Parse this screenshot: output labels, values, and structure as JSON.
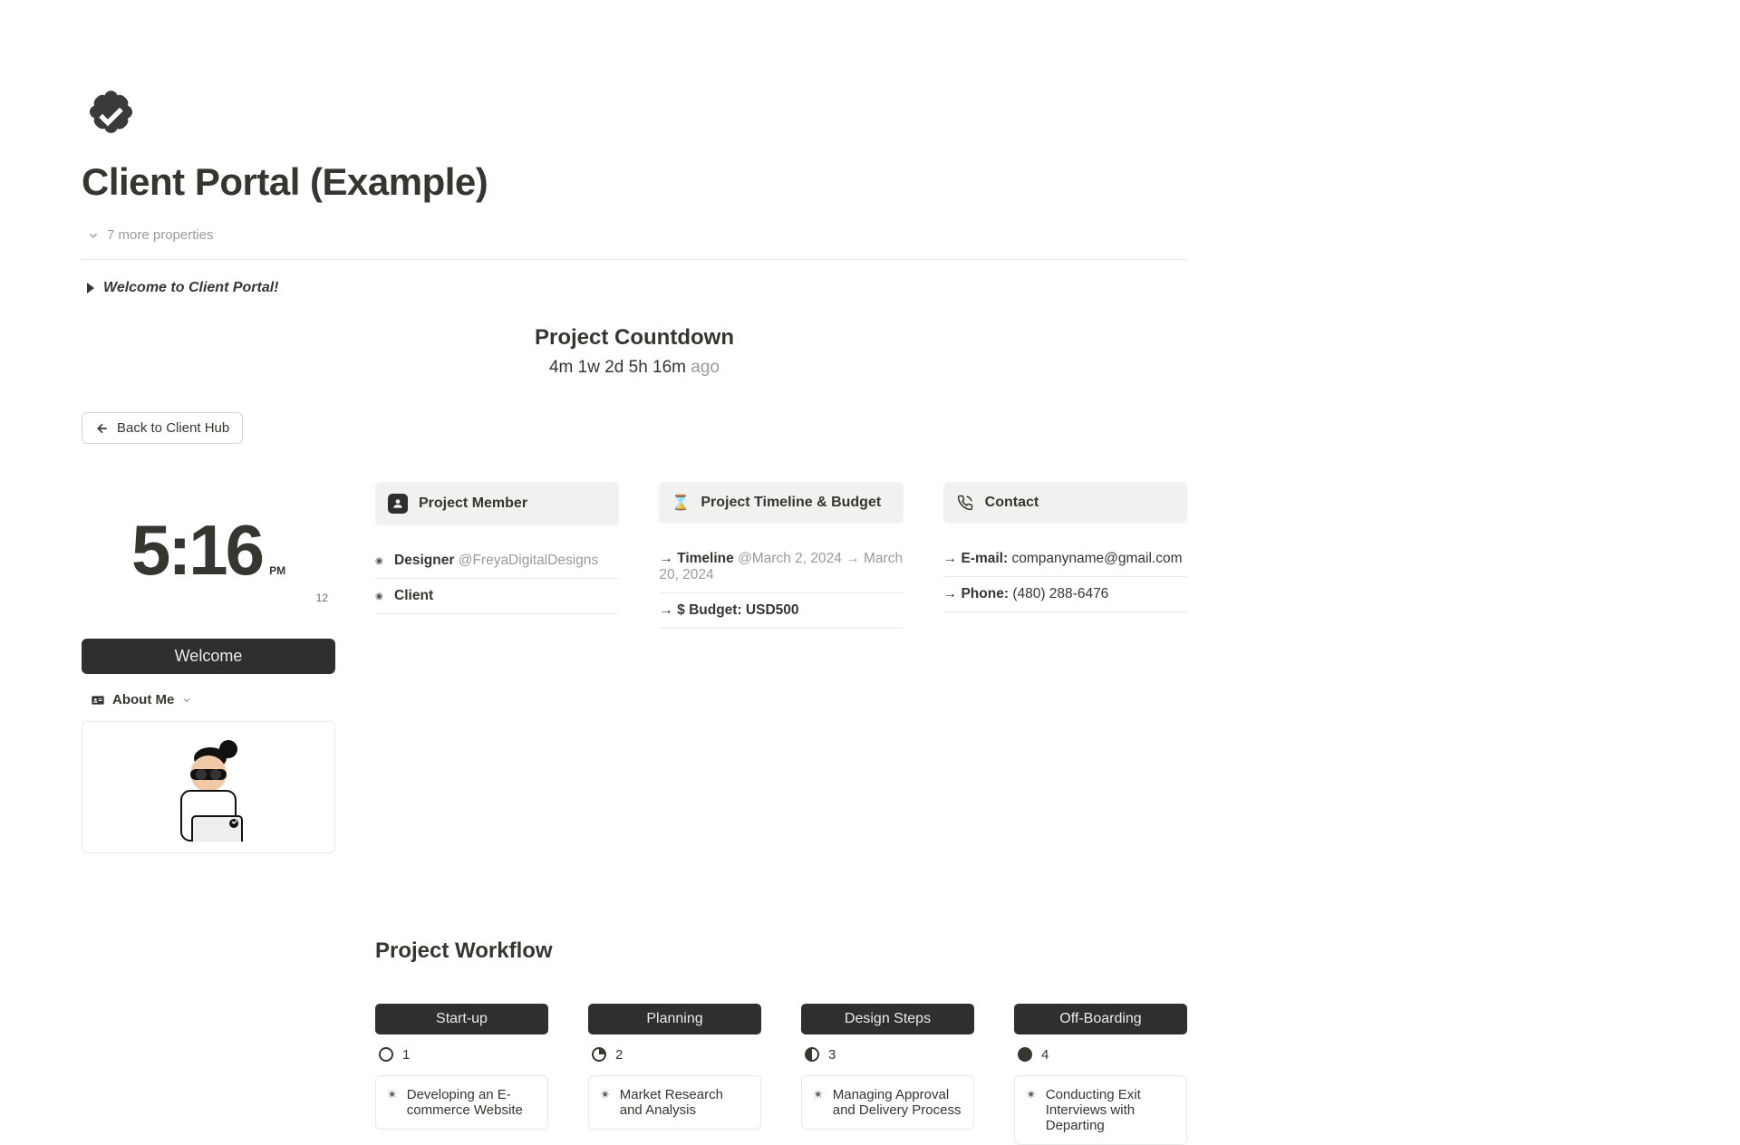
{
  "page": {
    "title": "Client Portal (Example)",
    "more_properties": "7 more properties",
    "welcome_toggle": "Welcome to Client Portal!",
    "countdown_title": "Project Countdown",
    "countdown_value": "4m 1w 2d 5h 16m",
    "countdown_suffix": "ago",
    "back_button": "Back to Client Hub"
  },
  "sidebar": {
    "clock_time": "5:16",
    "clock_ampm": "PM",
    "clock_date": "12",
    "welcome_bar": "Welcome",
    "about_me": "About Me"
  },
  "panels": {
    "member": {
      "title": "Project Member",
      "row1_label": "Designer",
      "row1_value": "@FreyaDigitalDesigns",
      "row2_label": "Client"
    },
    "timeline": {
      "title": "Project Timeline & Budget",
      "row1_label": "Timeline",
      "row1_value": "@March 2, 2024 → March 20, 2024",
      "row2": "$ Budget: USD500"
    },
    "contact": {
      "title": "Contact",
      "row1_label": "E-mail:",
      "row1_value": "companyname@gmail.com",
      "row2_label": "Phone:",
      "row2_value": "(480) 288-6476"
    }
  },
  "workflow": {
    "title": "Project Workflow",
    "cols": [
      {
        "head": "Start-up",
        "count": "1",
        "card": "Developing an E-commerce Website"
      },
      {
        "head": "Planning",
        "count": "2",
        "card": "Market Research and Analysis"
      },
      {
        "head": "Design Steps",
        "count": "3",
        "card": "Managing Approval and Delivery Process"
      },
      {
        "head": "Off-Boarding",
        "count": "4",
        "card": "Conducting Exit Interviews with Departing"
      }
    ]
  }
}
